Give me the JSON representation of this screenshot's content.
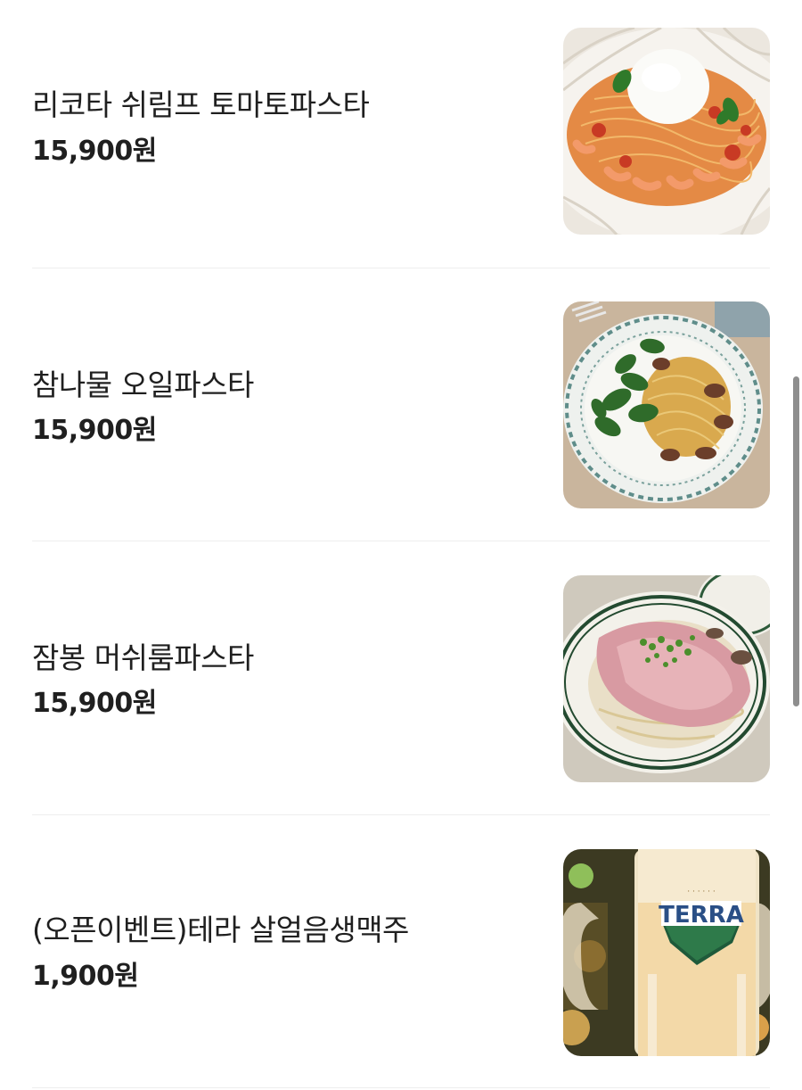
{
  "menu": {
    "items": [
      {
        "name": "리코타 쉬림프 토마토파스타",
        "price": "15,900원",
        "photo": "shrimp-tomato-pasta-photo"
      },
      {
        "name": "참나물 오일파스타",
        "price": "15,900원",
        "photo": "chamnamul-oil-pasta-photo"
      },
      {
        "name": "잠봉 머쉬룸파스타",
        "price": "15,900원",
        "photo": "jambon-mushroom-pasta-photo"
      },
      {
        "name": "(오픈이벤트)테라 살얼음생맥주",
        "price": "1,900원",
        "photo": "terra-beer-mug-photo",
        "mug_logo": "TERRA"
      }
    ]
  },
  "scrollbar": {
    "position": 0.48
  }
}
